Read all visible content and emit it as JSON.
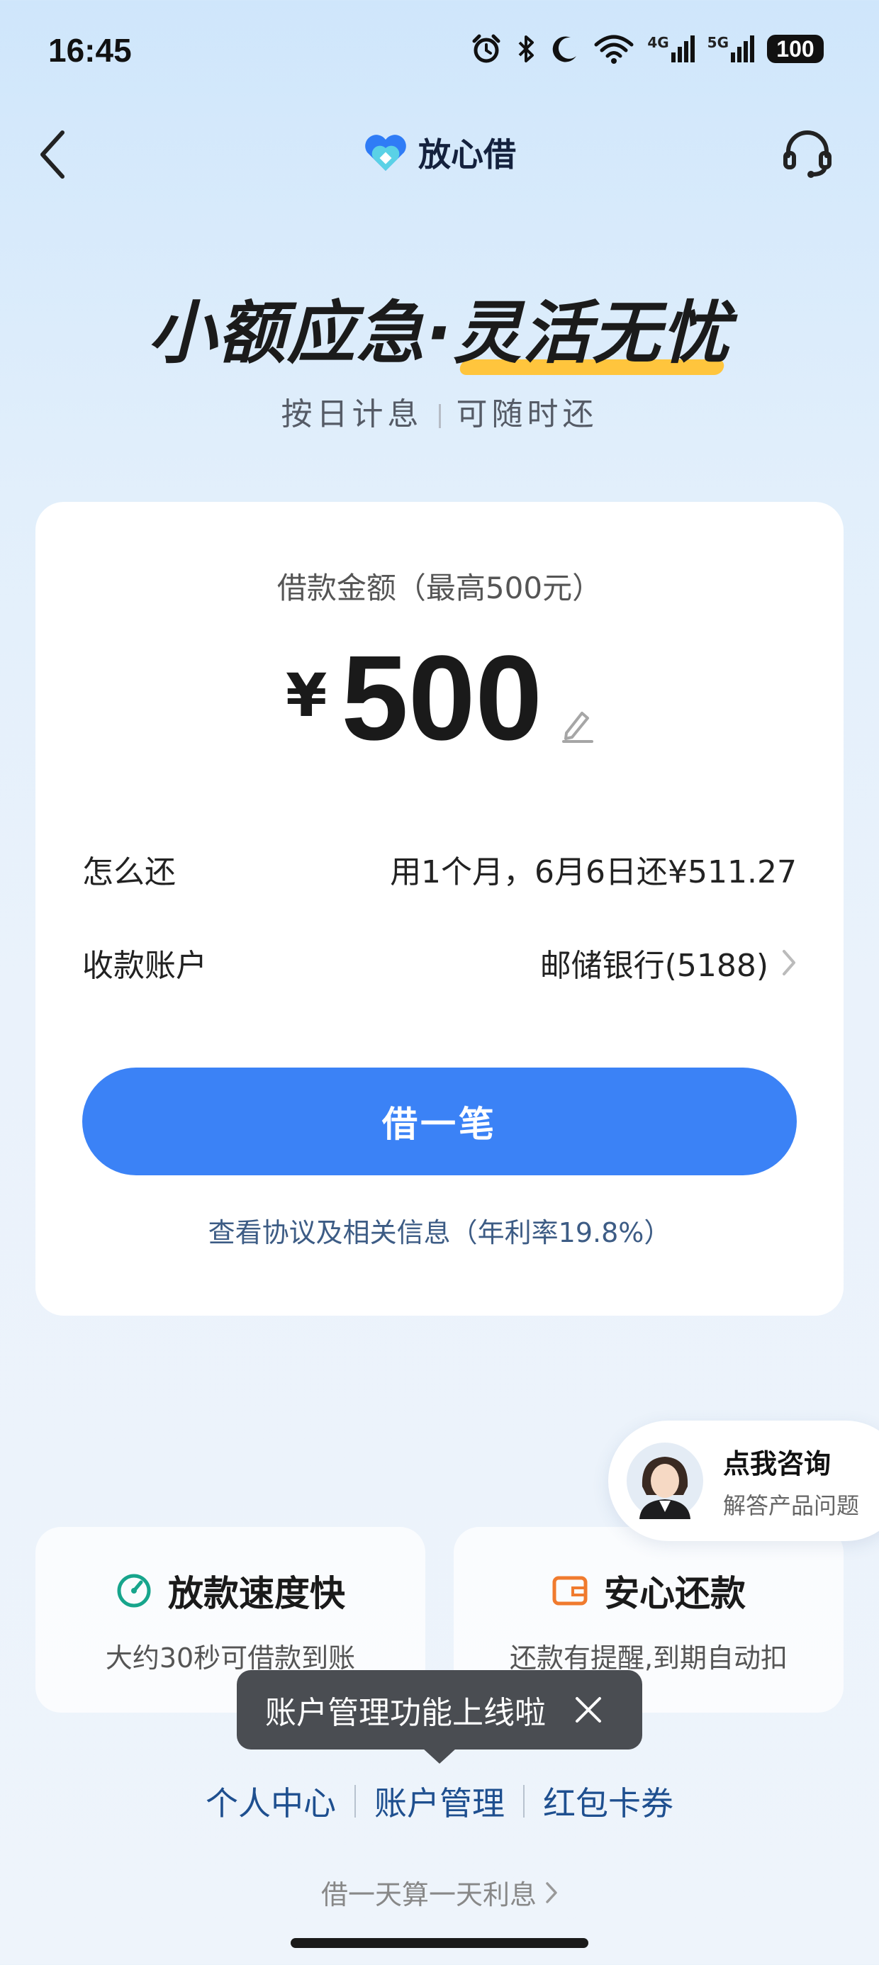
{
  "status_bar": {
    "time": "16:45",
    "signal1": "4G",
    "signal2": "5G",
    "battery": "100"
  },
  "nav": {
    "brand": "放心借"
  },
  "hero": {
    "headline_part1": "小额应急·",
    "headline_part2": "灵活无忧",
    "sub_left": "按日计息",
    "sub_right": "可随时还"
  },
  "card": {
    "amount_label": "借款金额（最高500元）",
    "currency": "¥",
    "amount": "500",
    "repay_label": "怎么还",
    "repay_value": "用1个月，6月6日还¥511.27",
    "account_label": "收款账户",
    "account_value": "邮储银行(5188)",
    "borrow_button": "借一笔",
    "agreement": "查看协议及相关信息（年利率19.8%）"
  },
  "consult": {
    "title": "点我咨询",
    "subtitle": "解答产品问题"
  },
  "features": [
    {
      "title": "放款速度快",
      "desc": "大约30秒可借款到账",
      "icon": "speedometer-icon",
      "color": "#17a58c"
    },
    {
      "title": "安心还款",
      "desc": "还款有提醒,到期自动扣",
      "icon": "wallet-icon",
      "color": "#f07b2e"
    }
  ],
  "tooltip": {
    "text": "账户管理功能上线啦"
  },
  "bottom_links": [
    "个人中心",
    "账户管理",
    "红包卡券"
  ],
  "bottom_note": "借一天算一天利息",
  "colors": {
    "primary": "#3b82f6",
    "link": "#3d5c85",
    "accent_yellow": "#ffc53d"
  }
}
